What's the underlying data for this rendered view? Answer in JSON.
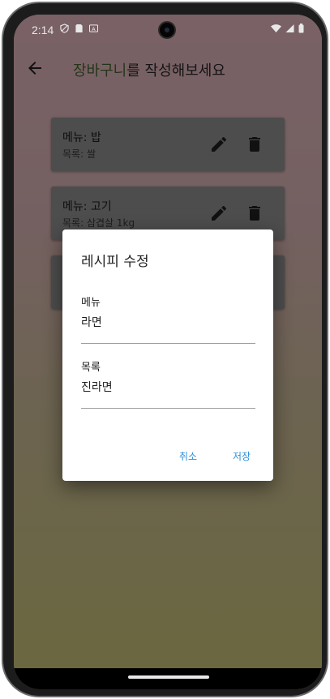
{
  "statusbar": {
    "time": "2:14",
    "left_icons": [
      "shield-icon",
      "sim-card-icon",
      "keyboard-icon"
    ],
    "right_icons": [
      "wifi-icon",
      "signal-icon",
      "battery-icon"
    ]
  },
  "appbar": {
    "back_icon": "arrow-back-icon",
    "title_accent": "장바구니",
    "title_rest": "를 작성해보세요",
    "accent_color": "#4a6a32"
  },
  "cards": [
    {
      "title": "메뉴: 밥",
      "subtitle": "목록: 쌀"
    },
    {
      "title": "메뉴: 고기",
      "subtitle": "목록: 삼겹살 1kg"
    },
    {
      "title": "",
      "subtitle": ""
    }
  ],
  "dialog": {
    "title": "레시피 수정",
    "menu_label": "메뉴",
    "menu_value": "라면",
    "list_label": "목록",
    "list_value": "진라면",
    "cancel_label": "취소",
    "save_label": "저장",
    "button_color": "#2e8fd8"
  }
}
